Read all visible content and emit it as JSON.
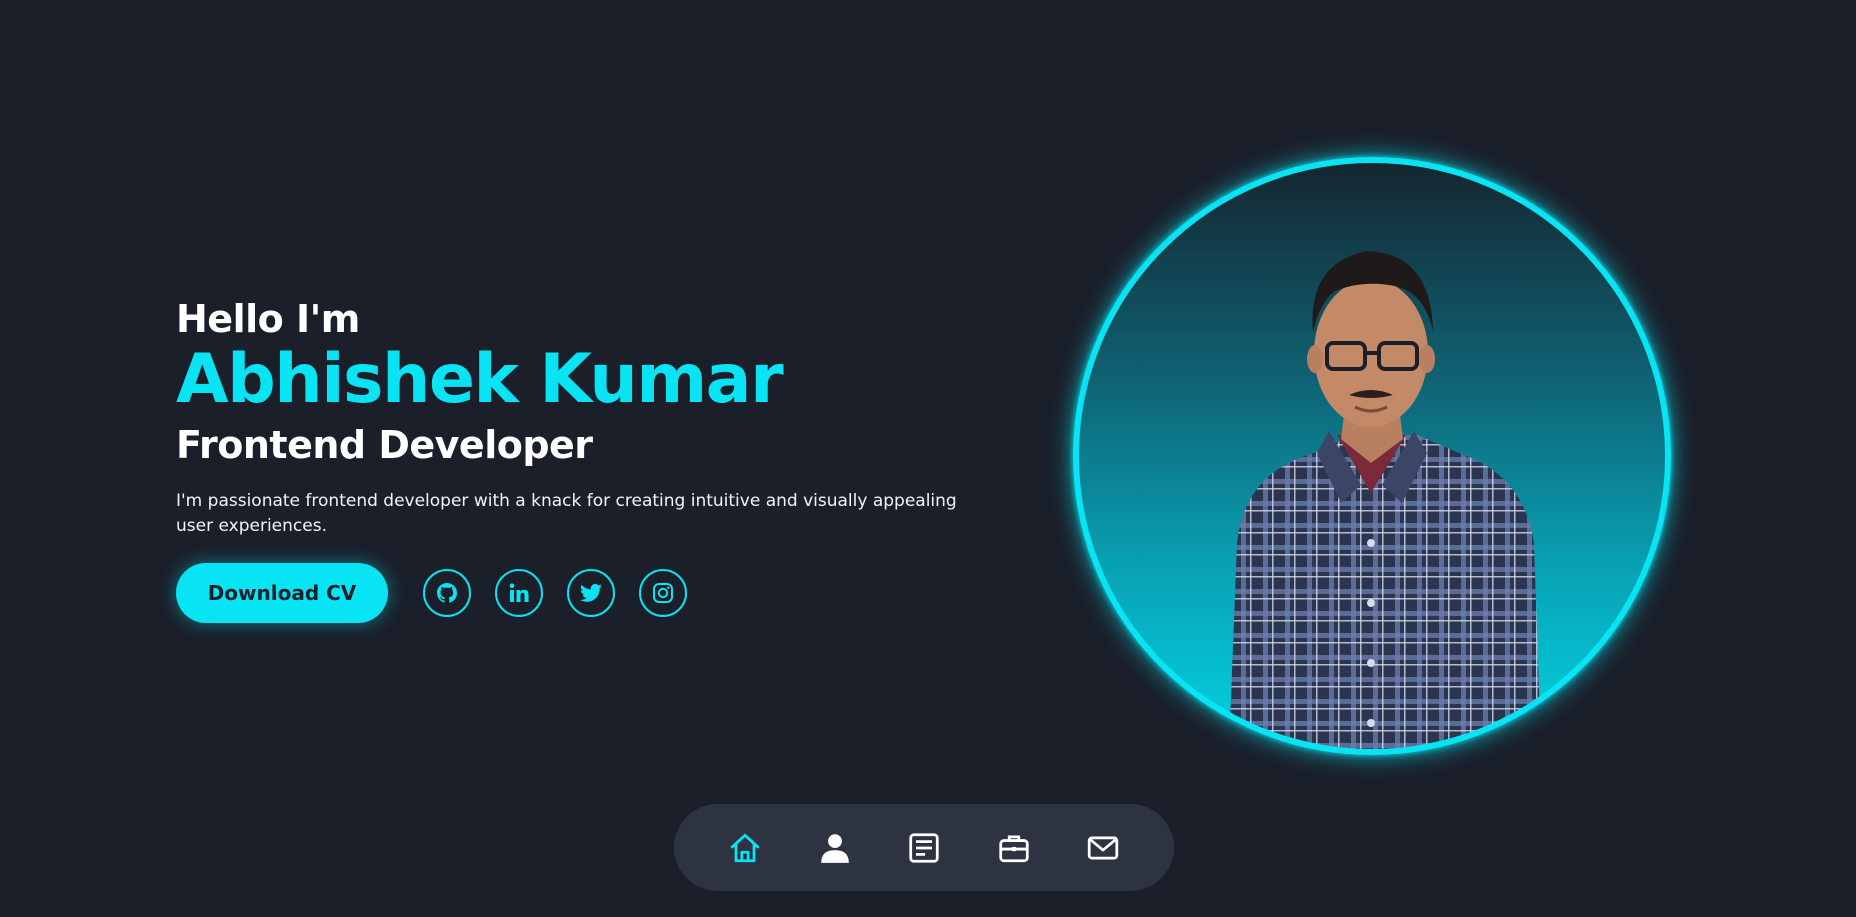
{
  "hero": {
    "greeting": "Hello I'm",
    "name": "Abhishek Kumar",
    "role": "Frontend Developer",
    "bio": "I'm passionate frontend developer with a knack for creating intuitive and visually appealing user experiences.",
    "cv_button": "Download CV"
  },
  "socials": [
    {
      "icon": "github-icon"
    },
    {
      "icon": "linkedin-icon"
    },
    {
      "icon": "twitter-icon"
    },
    {
      "icon": "instagram-icon"
    }
  ],
  "portrait": {
    "alt": "Profile photo"
  },
  "bottom_nav": {
    "active": "home",
    "items": [
      {
        "id": "home",
        "icon": "home-icon"
      },
      {
        "id": "about",
        "icon": "user-icon"
      },
      {
        "id": "resume",
        "icon": "document-icon"
      },
      {
        "id": "portfolio",
        "icon": "briefcase-icon"
      },
      {
        "id": "contact",
        "icon": "mail-icon"
      }
    ]
  },
  "colors": {
    "background": "#1a1f2a",
    "accent": "#08e4f4",
    "nav_background": "#2d3340",
    "text": "#ffffff"
  }
}
